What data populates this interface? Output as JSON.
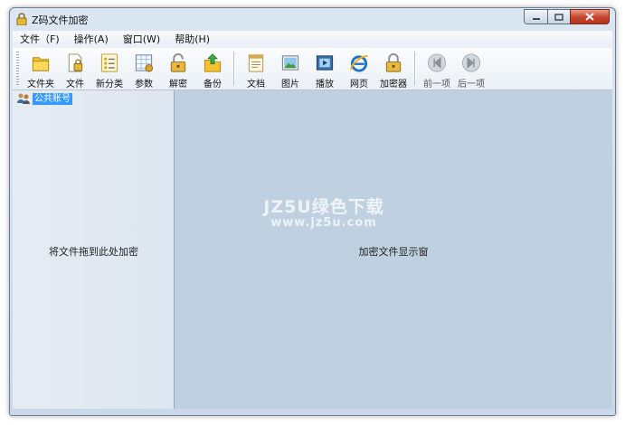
{
  "window": {
    "title": "Z码文件加密"
  },
  "menu": [
    {
      "label": "文件（F)"
    },
    {
      "label": "操作(A)"
    },
    {
      "label": "窗口(W)"
    },
    {
      "label": "帮助(H)"
    }
  ],
  "toolbar": {
    "group1": [
      {
        "label": "文件夹",
        "icon": "folder-icon"
      },
      {
        "label": "文件",
        "icon": "file-lock-icon"
      },
      {
        "label": "新分类",
        "icon": "category-list-icon"
      },
      {
        "label": "参数",
        "icon": "settings-sheet-icon"
      },
      {
        "label": "解密",
        "icon": "padlock-open-icon"
      },
      {
        "label": "备份",
        "icon": "backup-icon"
      }
    ],
    "group2": [
      {
        "label": "文档",
        "icon": "document-icon"
      },
      {
        "label": "图片",
        "icon": "picture-icon"
      },
      {
        "label": "播放",
        "icon": "video-icon"
      },
      {
        "label": "网页",
        "icon": "ie-browser-icon"
      },
      {
        "label": "加密器",
        "icon": "padlock-closed-icon"
      }
    ],
    "group3": [
      {
        "label": "前一项",
        "icon": "previous-icon"
      },
      {
        "label": "后一项",
        "icon": "next-icon"
      }
    ]
  },
  "tree": {
    "root_label": "公共账号"
  },
  "left_panel": {
    "hint": "将文件拖到此处加密"
  },
  "right_panel": {
    "hint": "加密文件显示窗"
  },
  "watermark": {
    "line1": "JZ5U绿色下载",
    "line2": "www.jz5u.com"
  },
  "colors": {
    "accent": "#3399ff",
    "right_panel_bg": "#bfd0e1",
    "close_button": "#c7432a"
  }
}
